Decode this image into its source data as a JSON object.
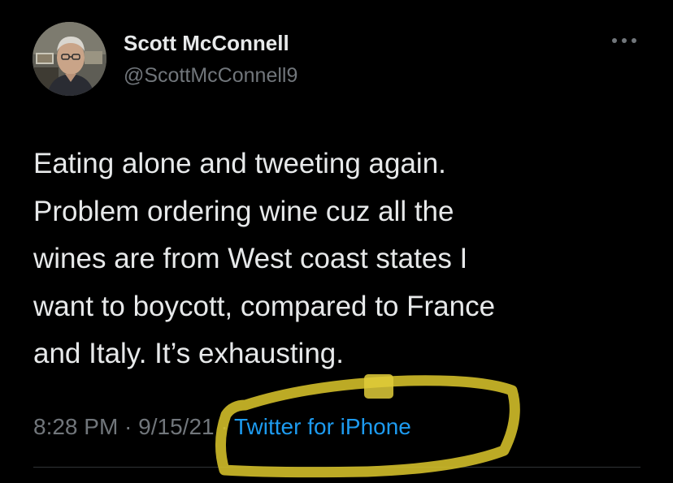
{
  "author": {
    "name": "Scott McConnell",
    "handle": "@ScottMcConnell9"
  },
  "tweet": {
    "lines": [
      "Eating alone and tweeting again.",
      "Problem ordering wine cuz all the",
      "wines are from West coast states I",
      "want to boycott, compared to France",
      "and Italy. It’s exhausting."
    ]
  },
  "meta": {
    "time": "8:28 PM",
    "separator": " · ",
    "date": "9/15/21",
    "source": "Twitter for iPhone"
  },
  "icons": {
    "more": "more-horizontal-icon"
  },
  "colors": {
    "background": "#000000",
    "text": "#e7e9ea",
    "secondary_text": "#71767b",
    "link": "#1d9bf0",
    "highlight_marker": "#d6c22a"
  }
}
